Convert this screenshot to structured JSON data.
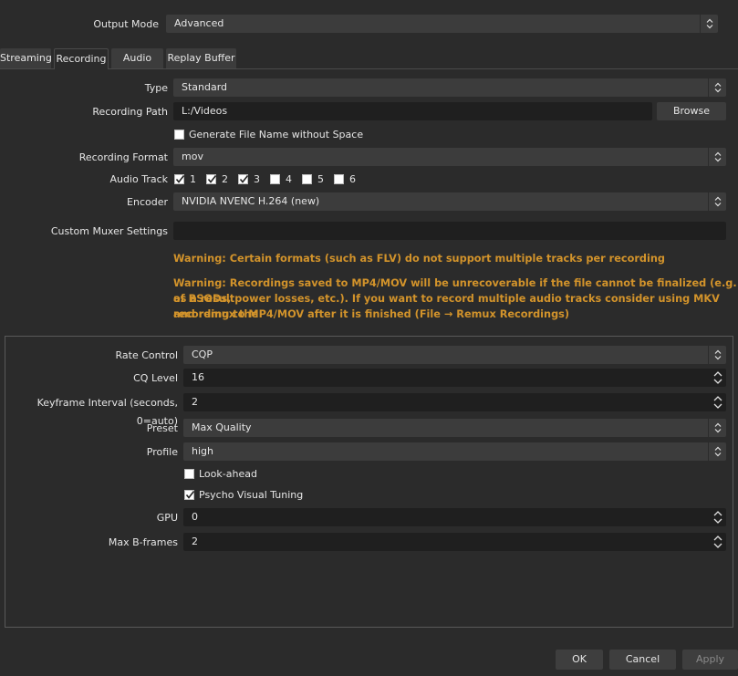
{
  "output_mode": {
    "label": "Output Mode",
    "value": "Advanced"
  },
  "tabs": [
    {
      "label": "Streaming"
    },
    {
      "label": "Recording"
    },
    {
      "label": "Audio"
    },
    {
      "label": "Replay Buffer"
    }
  ],
  "recording": {
    "type": {
      "label": "Type",
      "value": "Standard"
    },
    "path": {
      "label": "Recording Path",
      "value": "L:/Videos",
      "browse": "Browse"
    },
    "no_space": {
      "label": "Generate File Name without Space",
      "checked": false
    },
    "format": {
      "label": "Recording Format",
      "value": "mov"
    },
    "audio_track": {
      "label": "Audio Track",
      "tracks": [
        {
          "label": "1",
          "checked": true
        },
        {
          "label": "2",
          "checked": true
        },
        {
          "label": "3",
          "checked": true
        },
        {
          "label": "4",
          "checked": false
        },
        {
          "label": "5",
          "checked": false
        },
        {
          "label": "6",
          "checked": false
        }
      ]
    },
    "encoder": {
      "label": "Encoder",
      "value": "NVIDIA NVENC H.264 (new)"
    },
    "muxer": {
      "label": "Custom Muxer Settings",
      "value": ""
    },
    "warning1": "Warning: Certain formats (such as FLV) do not support multiple tracks per recording",
    "warning2_lines": [
      "Warning: Recordings saved to MP4/MOV will be unrecoverable if the file cannot be finalized (e.g. as a result",
      "of BSODs, power losses, etc.). If you want to record multiple audio tracks consider using MKV and remux the",
      "recording to MP4/MOV after it is finished (File → Remux Recordings)"
    ]
  },
  "encoder_settings": {
    "rate_control": {
      "label": "Rate Control",
      "value": "CQP"
    },
    "cq_level": {
      "label": "CQ Level",
      "value": "16"
    },
    "keyframe": {
      "label": "Keyframe Interval (seconds, 0=auto)",
      "value": "2"
    },
    "preset": {
      "label": "Preset",
      "value": "Max Quality"
    },
    "profile": {
      "label": "Profile",
      "value": "high"
    },
    "look_ahead": {
      "label": "Look-ahead",
      "checked": false
    },
    "psycho": {
      "label": "Psycho Visual Tuning",
      "checked": true
    },
    "gpu": {
      "label": "GPU",
      "value": "0"
    },
    "bframes": {
      "label": "Max B-frames",
      "value": "2"
    }
  },
  "buttons": {
    "ok": "OK",
    "cancel": "Cancel",
    "apply": "Apply"
  },
  "colors": {
    "background": "#2b2b2b",
    "field": "#3c3c3c",
    "warning": "#d2932b"
  },
  "icons": {
    "combo": "chevron-updown-icon",
    "spin": "spinner-arrows-icon",
    "check": "check-icon"
  }
}
